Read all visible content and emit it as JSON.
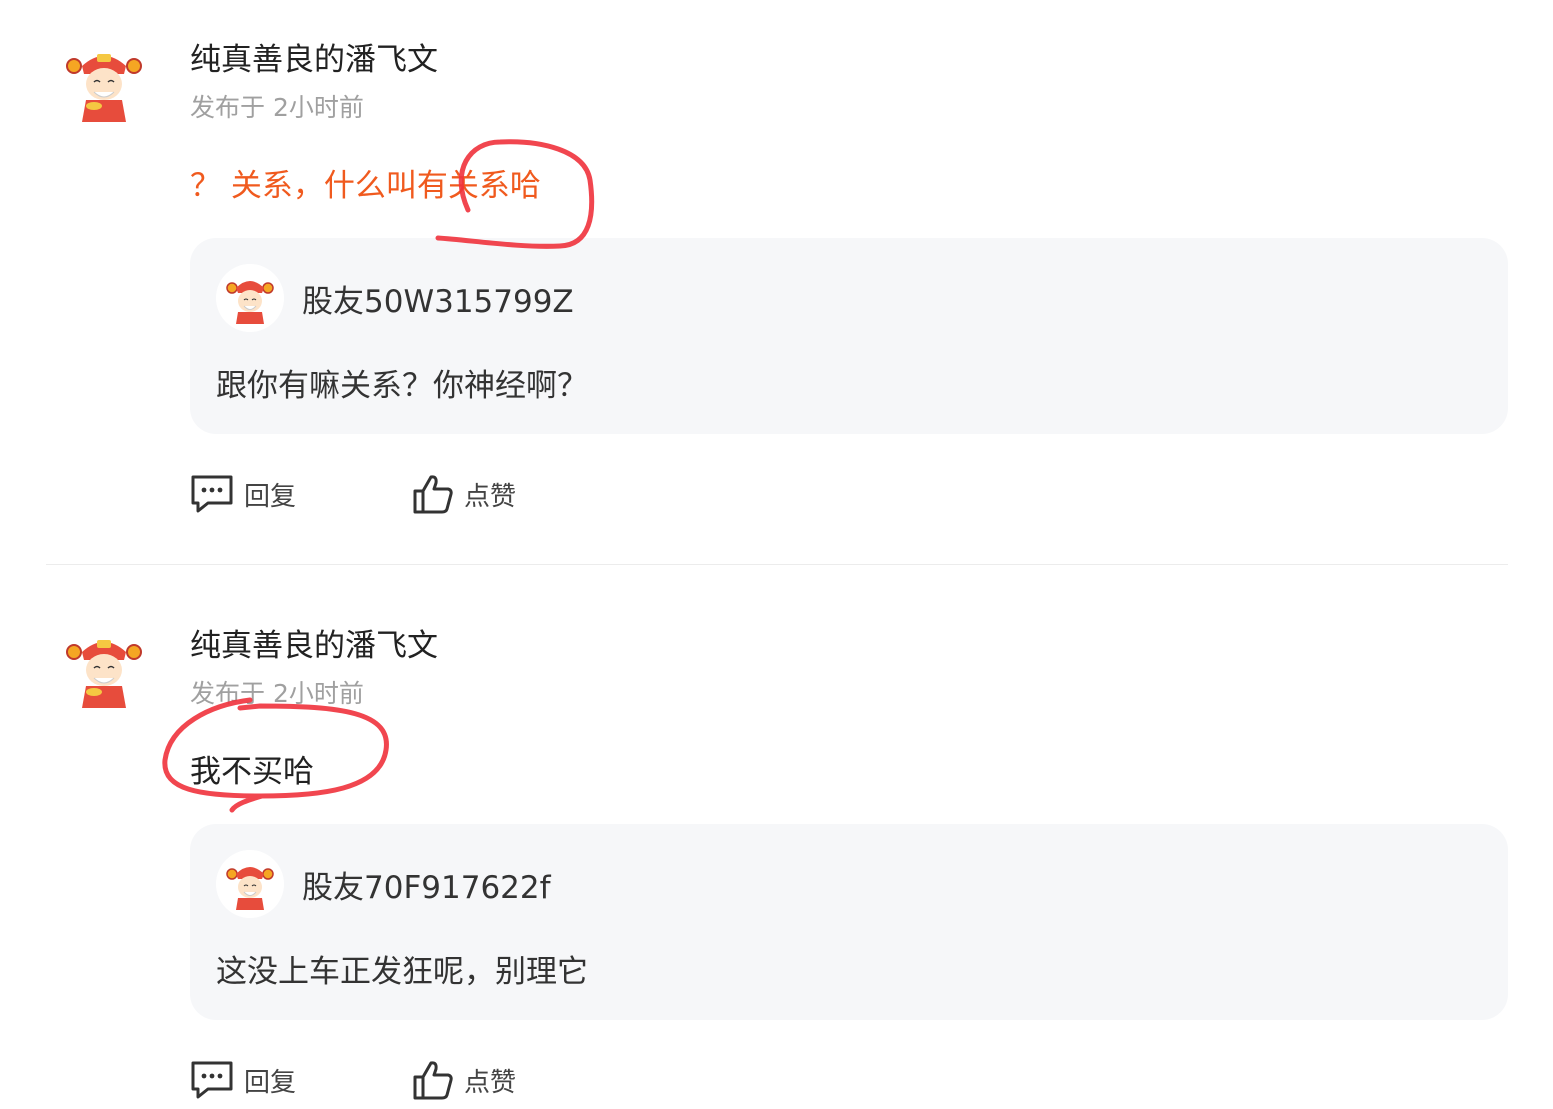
{
  "comments": [
    {
      "author": "纯真善良的潘飞文",
      "meta": "发布于 2小时前",
      "content": "？ 关系，什么叫有关系哈",
      "content_color": "#f05a1e",
      "quote": {
        "name": "股友50W315799Z",
        "text": "跟你有嘛关系？你神经啊？"
      },
      "reply_label": "回复",
      "like_label": "点赞"
    },
    {
      "author": "纯真善良的潘飞文",
      "meta": "发布于 2小时前",
      "content": "我不买哈",
      "content_color": "#222222",
      "quote": {
        "name": "股友70F917622f",
        "text": "这没上车正发狂呢，别理它"
      },
      "reply_label": "回复",
      "like_label": "点赞"
    }
  ],
  "colors": {
    "annotation_red": "#f0323c",
    "accent_orange": "#f05a1e",
    "quote_bg": "#f6f7f9",
    "meta_gray": "#a0a0a0"
  }
}
